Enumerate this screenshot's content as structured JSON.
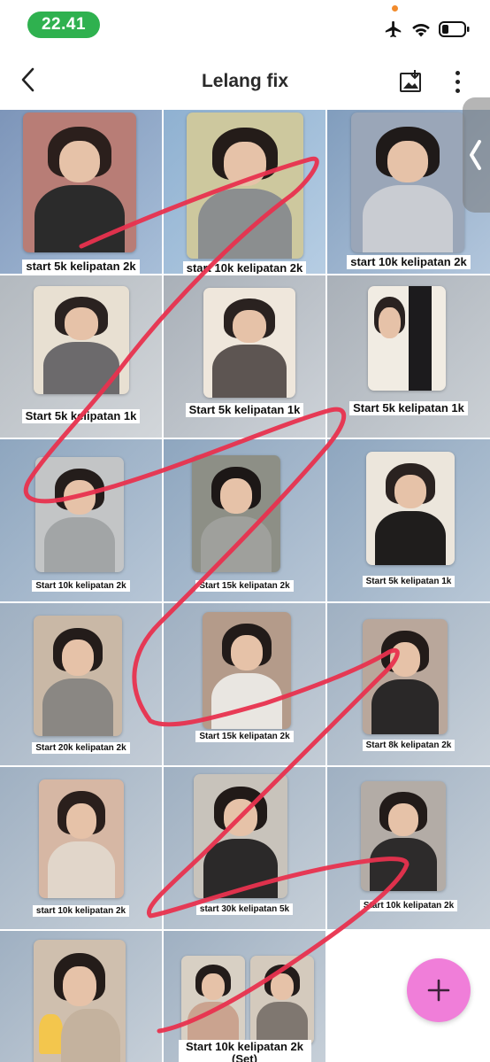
{
  "status_bar": {
    "time": "22.41",
    "icons": [
      "airplane-mode-icon",
      "wifi-icon",
      "battery-icon"
    ]
  },
  "app_bar": {
    "title": "Lelang fix",
    "back_icon": "chevron-left-icon",
    "image_icon": "image-select-icon",
    "menu_icon": "more-vertical-icon"
  },
  "photos": [
    {
      "caption": "start 5k kelipatan 2k"
    },
    {
      "caption": "start 10k kelipatan 2k"
    },
    {
      "caption": "start 10k kelipatan 2k"
    },
    {
      "caption": "Start 5k kelipatan 1k"
    },
    {
      "caption": "Start 5k kelipatan 1k"
    },
    {
      "caption": "Start 5k kelipatan 1k"
    },
    {
      "caption": "Start 10k kelipatan 2k"
    },
    {
      "caption": "Start 15k kelipatan 2k"
    },
    {
      "caption": "Start 5k kelipatan 1k"
    },
    {
      "caption": "Start 20k kelipatan 2k"
    },
    {
      "caption": "Start 15k kelipatan 2k"
    },
    {
      "caption": "Start 8k kelipatan 2k"
    },
    {
      "caption": "start 10k kelipatan 2k"
    },
    {
      "caption": "start 30k kelipatan 5k"
    },
    {
      "caption": "Start 10k kelipatan 2k"
    },
    {
      "caption": ""
    },
    {
      "caption": "Start 10k kelipatan 2k (Set)"
    }
  ],
  "fab": {
    "icon": "plus-icon"
  },
  "side_handle": {
    "icon": "chevron-left-icon"
  },
  "colors": {
    "time_pill": "#2fb14f",
    "fab": "#f07ed9",
    "scribble": "#e8314e"
  }
}
